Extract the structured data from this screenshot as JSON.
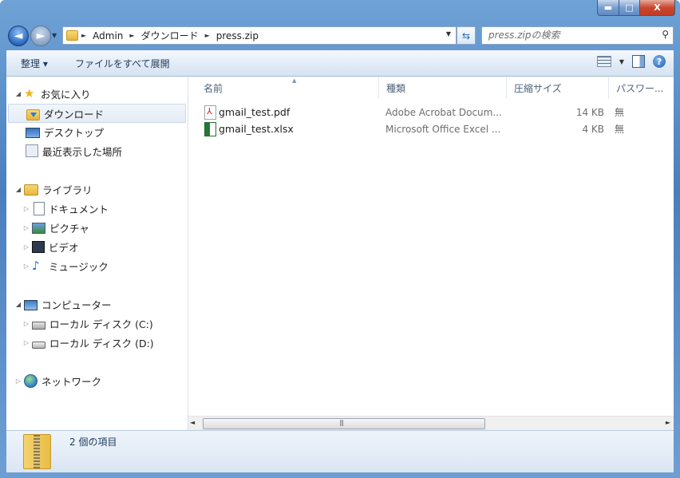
{
  "window": {
    "controls": {
      "minimize": "▬",
      "maximize": "□",
      "close": "X"
    }
  },
  "nav": {
    "back_icon": "arrow-left-icon",
    "forward_icon": "arrow-right-icon",
    "breadcrumb": [
      "Admin",
      "ダウンロード",
      "press.zip"
    ],
    "search_placeholder": "press.zipの検索"
  },
  "toolbar": {
    "organize_label": "整理 ▾",
    "extract_label": "ファイルをすべて展開"
  },
  "sidebar": {
    "favorites": "お気に入り",
    "downloads": "ダウンロード",
    "desktop": "デスクトップ",
    "recent": "最近表示した場所",
    "libraries": "ライブラリ",
    "documents": "ドキュメント",
    "pictures": "ピクチャ",
    "videos": "ビデオ",
    "music": "ミュージック",
    "computer": "コンピューター",
    "drive_c": "ローカル ディスク (C:)",
    "drive_d": "ローカル ディスク (D:)",
    "network": "ネットワーク"
  },
  "columns": {
    "name": "名前",
    "type": "種類",
    "compressed_size": "圧縮サイズ",
    "password": "パスワー..."
  },
  "files": [
    {
      "name": "gmail_test.pdf",
      "type": "Adobe Acrobat Docum...",
      "size": "14 KB",
      "password": "無"
    },
    {
      "name": "gmail_test.xlsx",
      "type": "Microsoft Office Excel ...",
      "size": "4 KB",
      "password": "無"
    }
  ],
  "details": {
    "item_count": "2 個の項目"
  },
  "colors": {
    "frame": "#4a7fbe",
    "selection": "#e4ecf6",
    "close_button": "#c9472e"
  }
}
